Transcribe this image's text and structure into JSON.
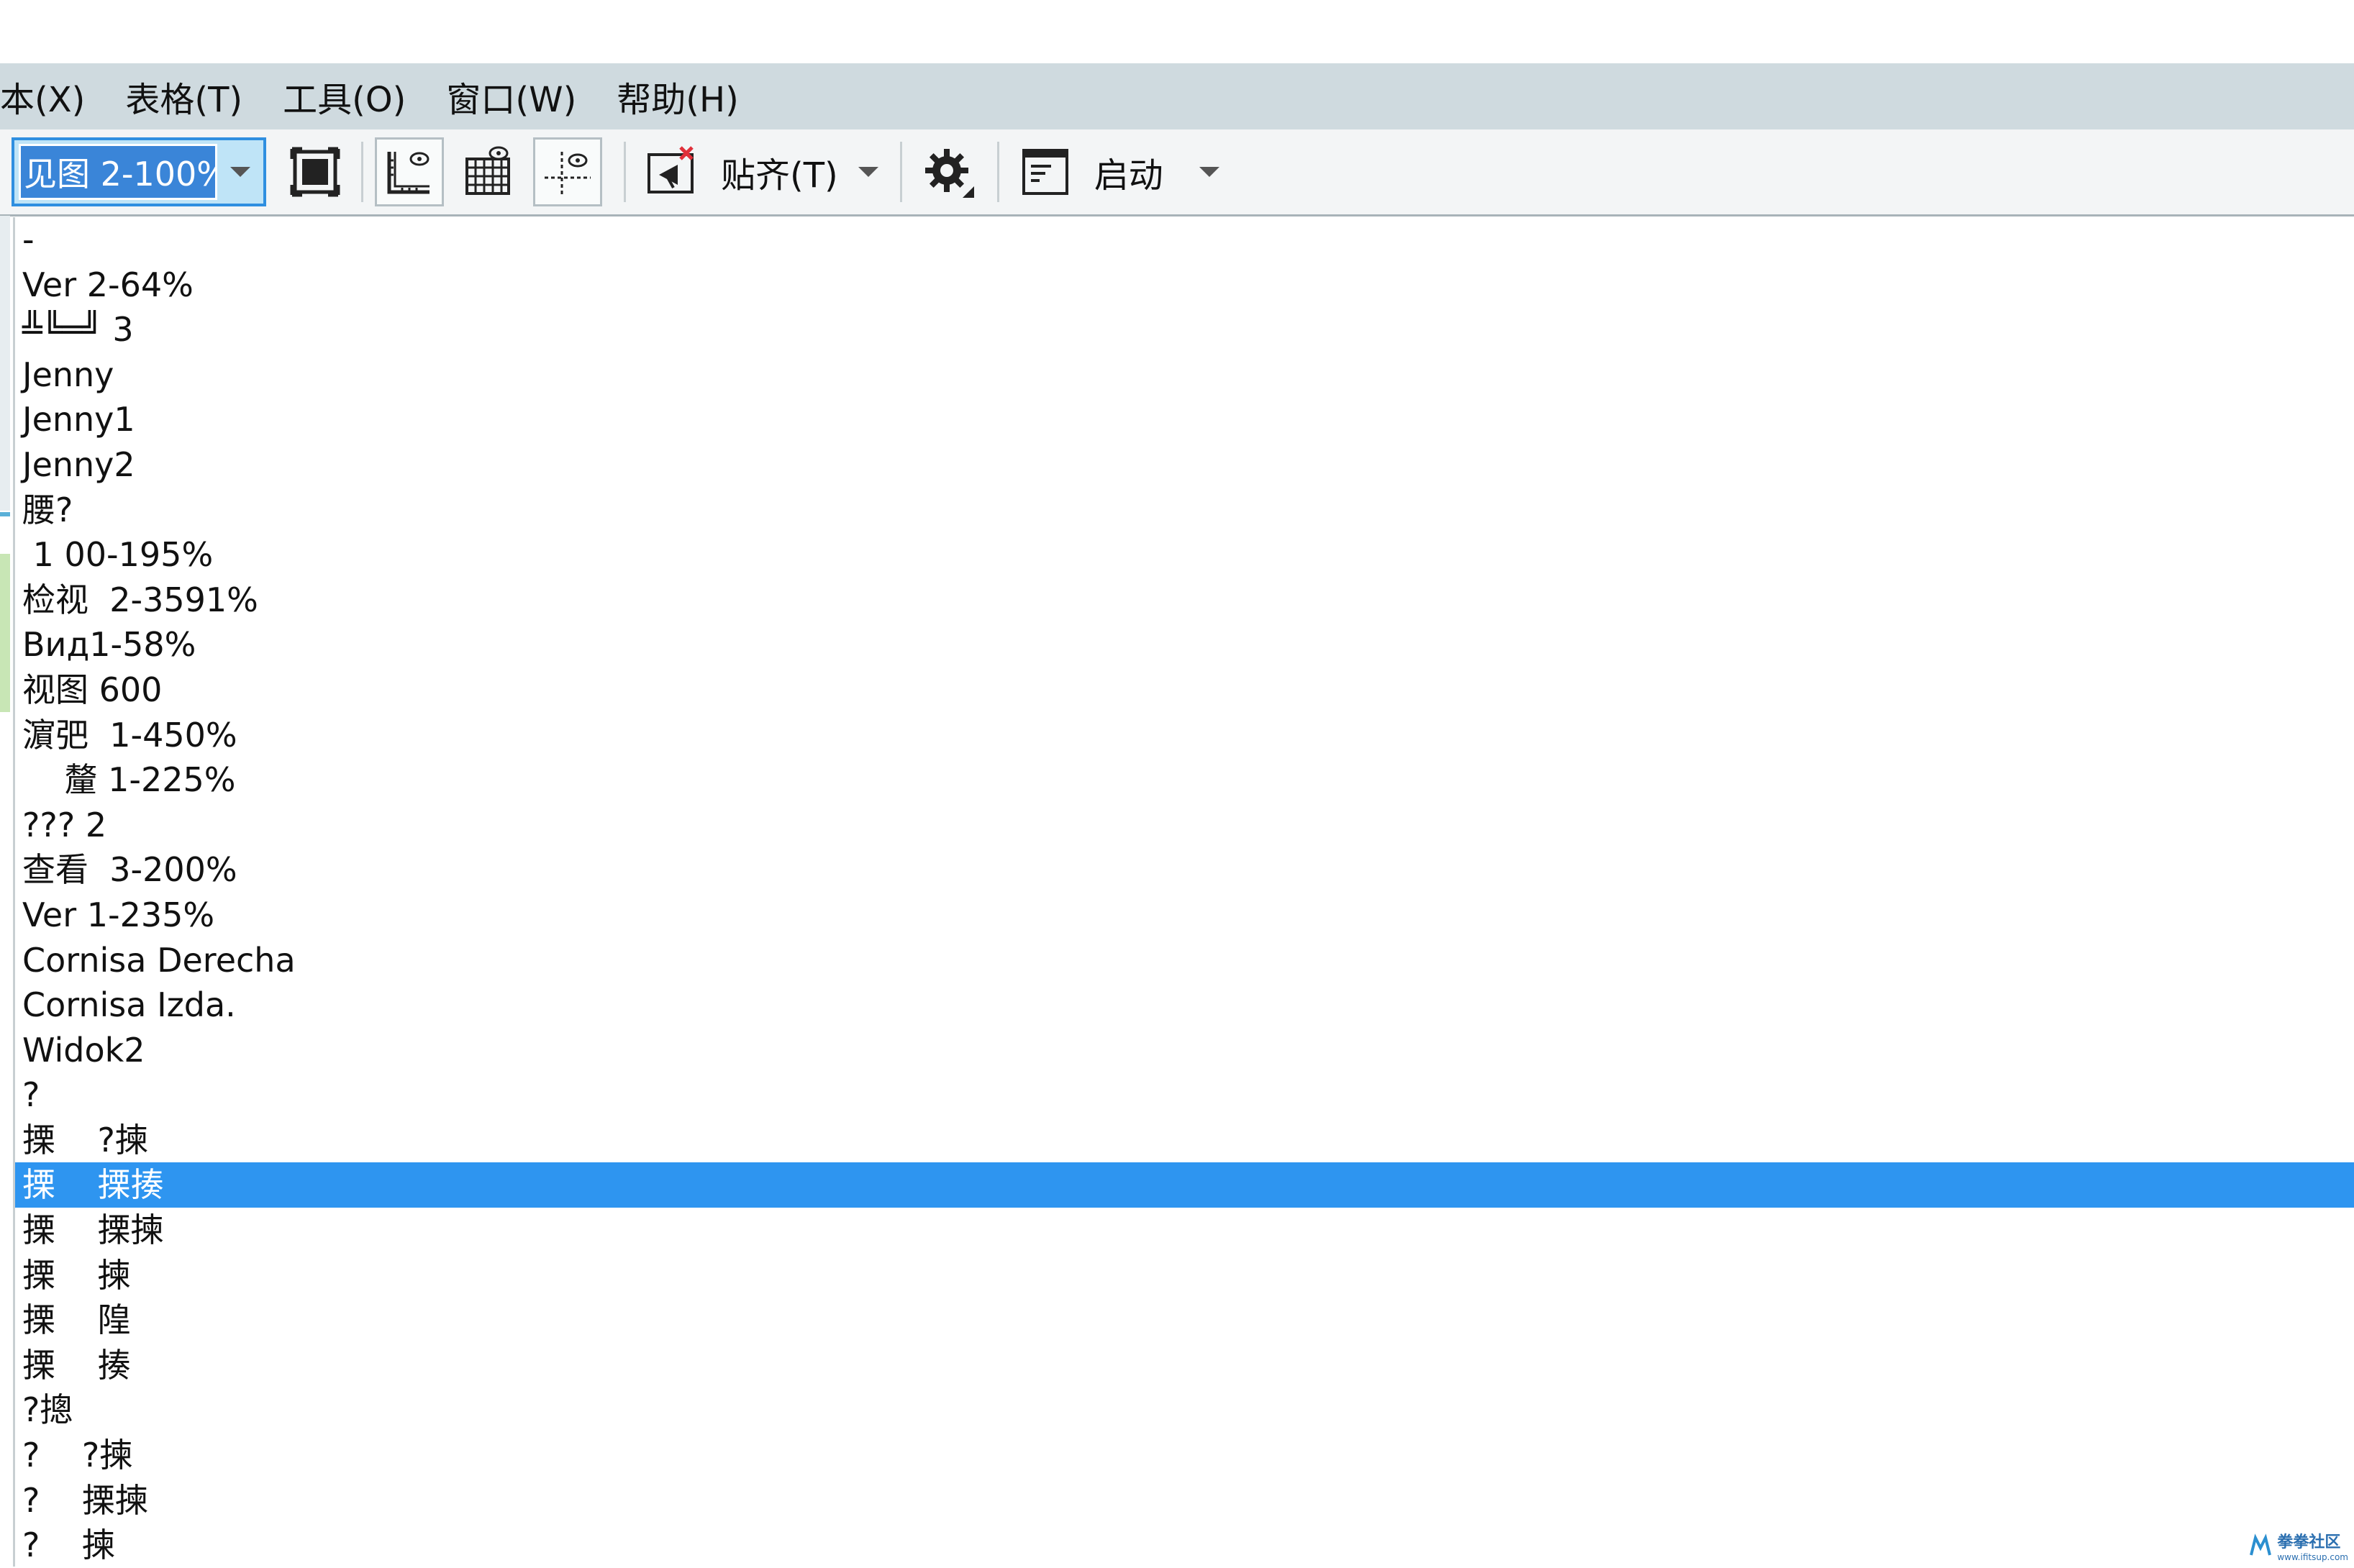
{
  "menubar": {
    "items": [
      {
        "label": "本(X)"
      },
      {
        "label": "表格(T)"
      },
      {
        "label": "工具(O)"
      },
      {
        "label": "窗口(W)"
      },
      {
        "label": "帮助(H)"
      }
    ]
  },
  "toolbar": {
    "view_combo_value": "见图 2-100%",
    "snap_label": "贴齐(T)",
    "launch_label": "启动"
  },
  "list": {
    "selected_index": 21,
    "items": [
      "-",
      "Ver 2-64%",
      "╩╚═╝ 3",
      "Jenny",
      "Jenny1",
      "Jenny2",
      "腰?",
      " 1 00-195%",
      "检视  2-3591%",
      "Вид1-58%",
      "视图 600",
      "濵弝  1-450%",
      "    釐 1-225%",
      "??? 2",
      "查看  3-200%",
      "Ver 1-235%",
      "Cornisa Derecha",
      "Cornisa Izda.",
      "Widok2",
      "?",
      "搮    ?揀",
      "搮    搮揍",
      "搮    搮揀",
      "搮    揀",
      "搮    隍",
      "搮    揍",
      "?摠",
      "?    ?揀",
      "?    搮揀",
      "?    揀"
    ]
  },
  "watermark": {
    "text": "拳拳社区",
    "sub": "www.ifitsup.com"
  },
  "colors": {
    "menubar_bg": "#cfdadf",
    "toolbar_bg": "#f3f5f6",
    "selection": "#2e95f0",
    "combo_border": "#2f8fe0"
  }
}
